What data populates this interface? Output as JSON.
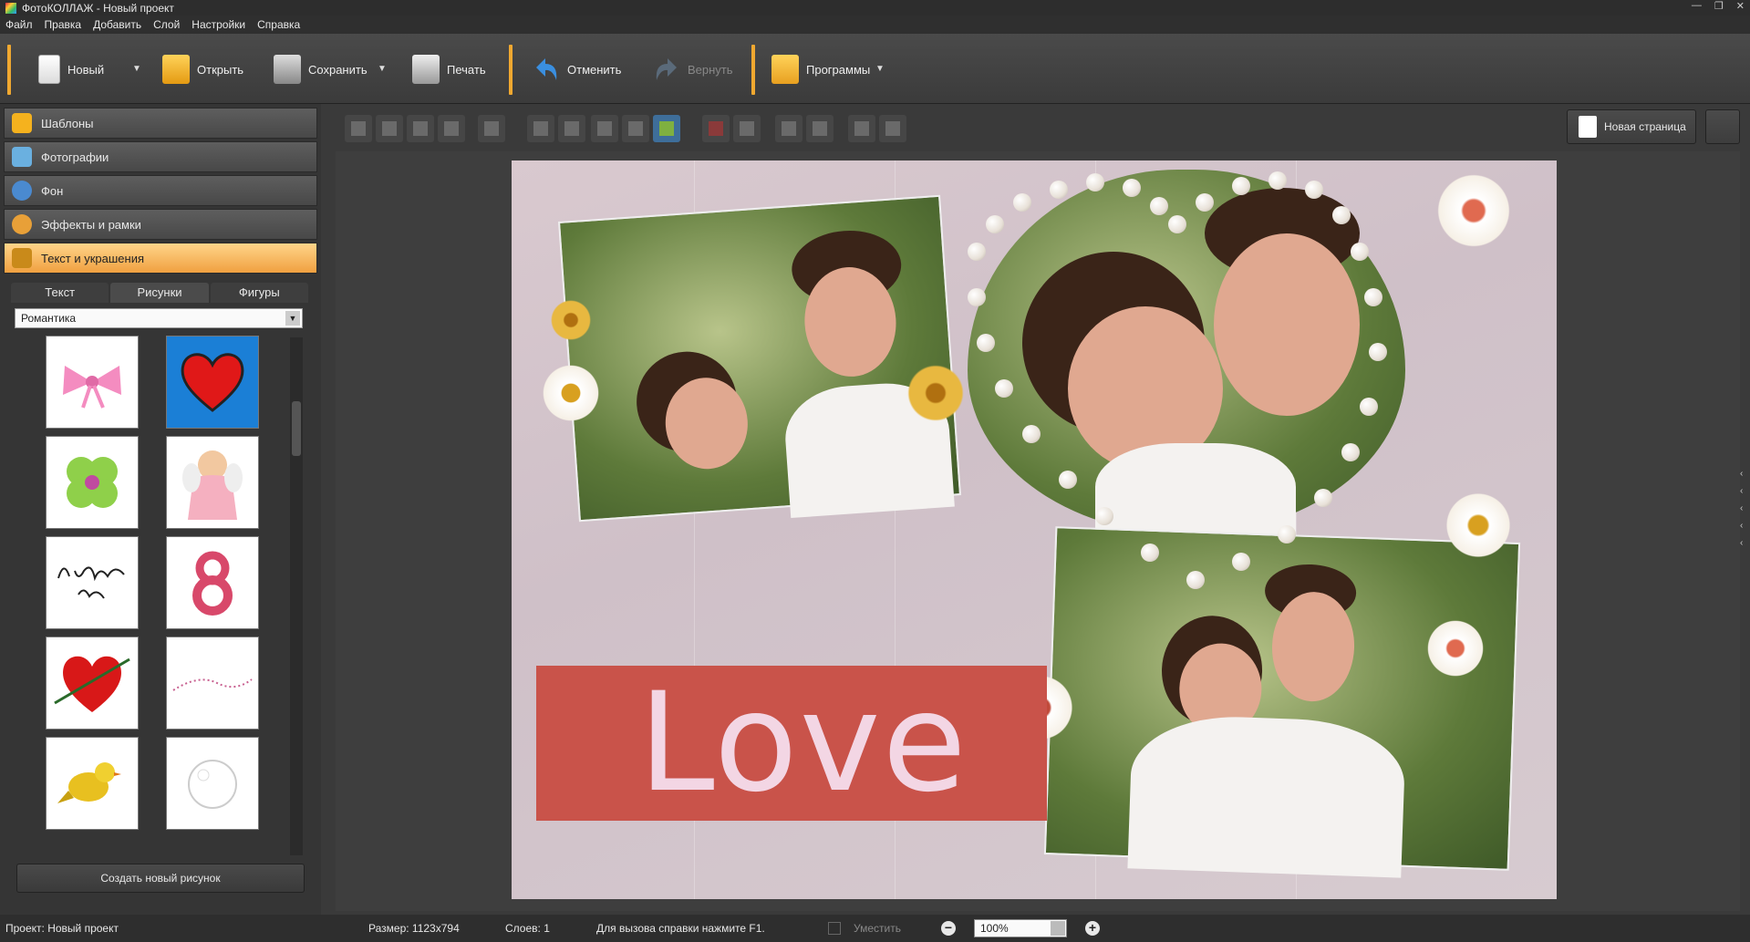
{
  "titlebar": {
    "title": "ФотоКОЛЛАЖ - Новый проект"
  },
  "menu": [
    "Файл",
    "Правка",
    "Добавить",
    "Слой",
    "Настройки",
    "Справка"
  ],
  "toolbar": {
    "new": "Новый",
    "open": "Открыть",
    "save": "Сохранить",
    "print": "Печать",
    "undo": "Отменить",
    "redo": "Вернуть",
    "programs": "Программы"
  },
  "sidebar": {
    "sections": [
      "Шаблоны",
      "Фотографии",
      "Фон",
      "Эффекты и рамки",
      "Текст и украшения"
    ],
    "active_section": "Текст и украшения",
    "tabs": [
      "Текст",
      "Рисунки",
      "Фигуры"
    ],
    "active_tab": "Рисунки",
    "category": "Романтика",
    "thumbnails": [
      "bow",
      "heart",
      "clover",
      "angel",
      "ps-i-love-you",
      "number-8",
      "heart-arrow",
      "bead-string",
      "yellow-bird",
      "bubble"
    ],
    "create_button": "Создать новый рисунок"
  },
  "editor": {
    "new_page": "Новая страница",
    "canvas_text": "Love"
  },
  "status": {
    "project": "Проект: Новый проект",
    "size": "Размер:  1123x794",
    "layers": "Слоев:  1",
    "hint": "Для вызова справки нажмите F1.",
    "fit": "Уместить",
    "zoom": "100%"
  },
  "colors": {
    "accent": "#f0a830",
    "banner": "#c9534a",
    "selection": "#1b7fd6"
  }
}
